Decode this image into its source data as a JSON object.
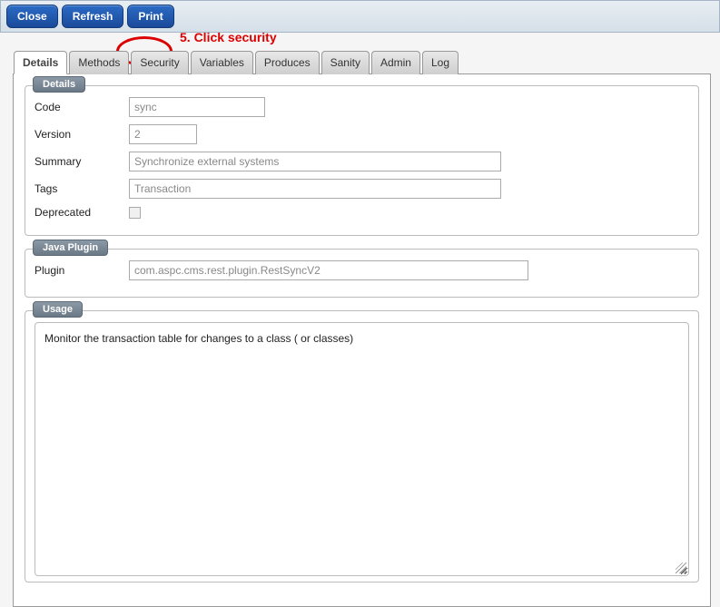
{
  "toolbar": {
    "close": "Close",
    "refresh": "Refresh",
    "print": "Print"
  },
  "annotation": "5. Click security",
  "tabs": {
    "details": "Details",
    "methods": "Methods",
    "security": "Security",
    "variables": "Variables",
    "produces": "Produces",
    "sanity": "Sanity",
    "admin": "Admin",
    "log": "Log"
  },
  "details": {
    "legend": "Details",
    "code_label": "Code",
    "code_value": "sync",
    "version_label": "Version",
    "version_value": "2",
    "summary_label": "Summary",
    "summary_value": "Synchronize external systems",
    "tags_label": "Tags",
    "tags_value": "Transaction",
    "deprecated_label": "Deprecated"
  },
  "plugin": {
    "legend": "Java Plugin",
    "plugin_label": "Plugin",
    "plugin_value": "com.aspc.cms.rest.plugin.RestSyncV2"
  },
  "usage": {
    "legend": "Usage",
    "text": "Monitor the transaction table for changes to a class ( or classes)"
  }
}
